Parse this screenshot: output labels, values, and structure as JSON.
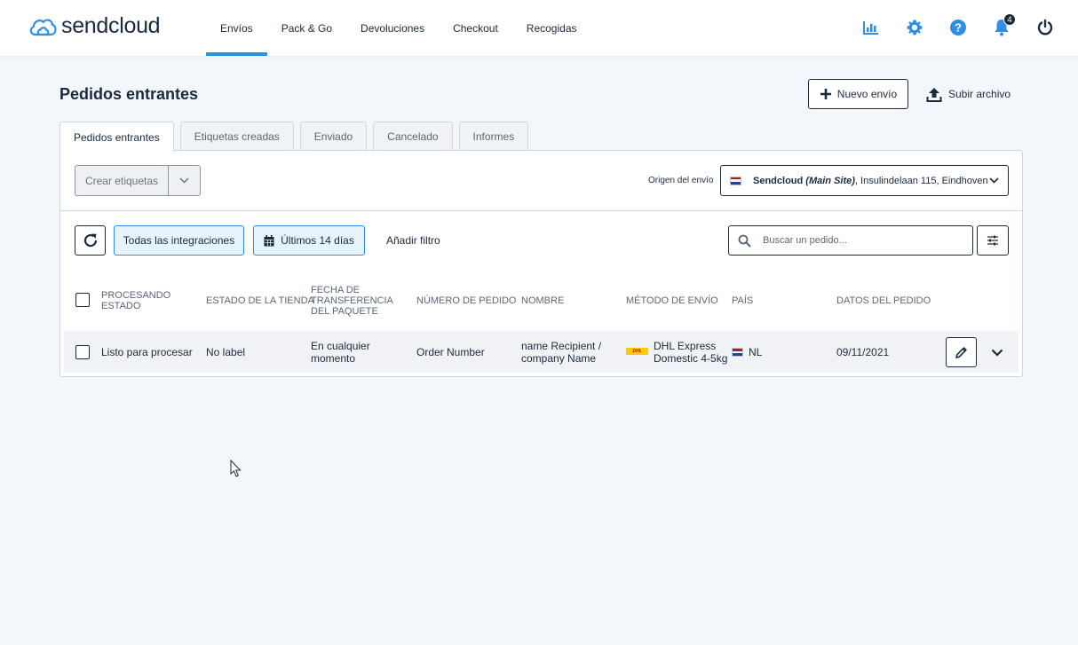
{
  "app": {
    "logo_text": "sendcloud",
    "notification_count": "4"
  },
  "nav": {
    "items": [
      "Envíos",
      "Pack & Go",
      "Devoluciones",
      "Checkout",
      "Recogidas"
    ],
    "active_index": 0
  },
  "header_icons": [
    "analytics-icon",
    "gear-icon",
    "help-icon",
    "bell-icon",
    "power-icon"
  ],
  "page": {
    "title": "Pedidos entrantes",
    "new_shipment": "Nuevo envío",
    "upload_file": "Subir archivo"
  },
  "tabs": [
    "Pedidos entrantes",
    "Etiquetas creadas",
    "Enviado",
    "Cancelado",
    "Informes"
  ],
  "toolbar": {
    "create_labels": "Crear etiquetas",
    "origin_label": "Origen del envío",
    "origin_name": "Sendcloud",
    "origin_site": "(Main Site)",
    "origin_address": ", Insulindelaan 115, Eindhoven"
  },
  "filters": {
    "integrations": "Todas las integraciones",
    "date_range": "Últimos 14 días",
    "add_filter": "Añadir filtro",
    "search_placeholder": "Buscar un pedido..."
  },
  "table": {
    "headers": {
      "status": "PROCESANDO ESTADO",
      "store_status": "ESTADO DE LA TIENDA",
      "transfer_date": "FECHA DE TRANSFERENCIA DEL PAQUETE",
      "order_number": "NÚMERO DE PEDIDO",
      "name": "NOMBRE",
      "shipping_method": "MÉTODO DE ENVÍO",
      "country": "PAÍS",
      "order_date": "DATOS DEL PEDIDO"
    },
    "rows": [
      {
        "status": "Listo para procesar",
        "store_status": "No label",
        "transfer_date": "En cualquier momento",
        "order_number": "Order Number",
        "name": "name Recipient / company Name",
        "shipping_method": "DHL Express Domestic 4-5kg",
        "carrier_logo_text": "DHL",
        "country": "NL",
        "order_date": "09/11/2021"
      }
    ]
  },
  "colors": {
    "accent": "#2f8ee8",
    "text": "#1c2a3d",
    "background": "#f3f7fc",
    "chip_bg": "#e7f3fd",
    "dhl_yellow": "#ffcc00",
    "dhl_red": "#d40511"
  }
}
